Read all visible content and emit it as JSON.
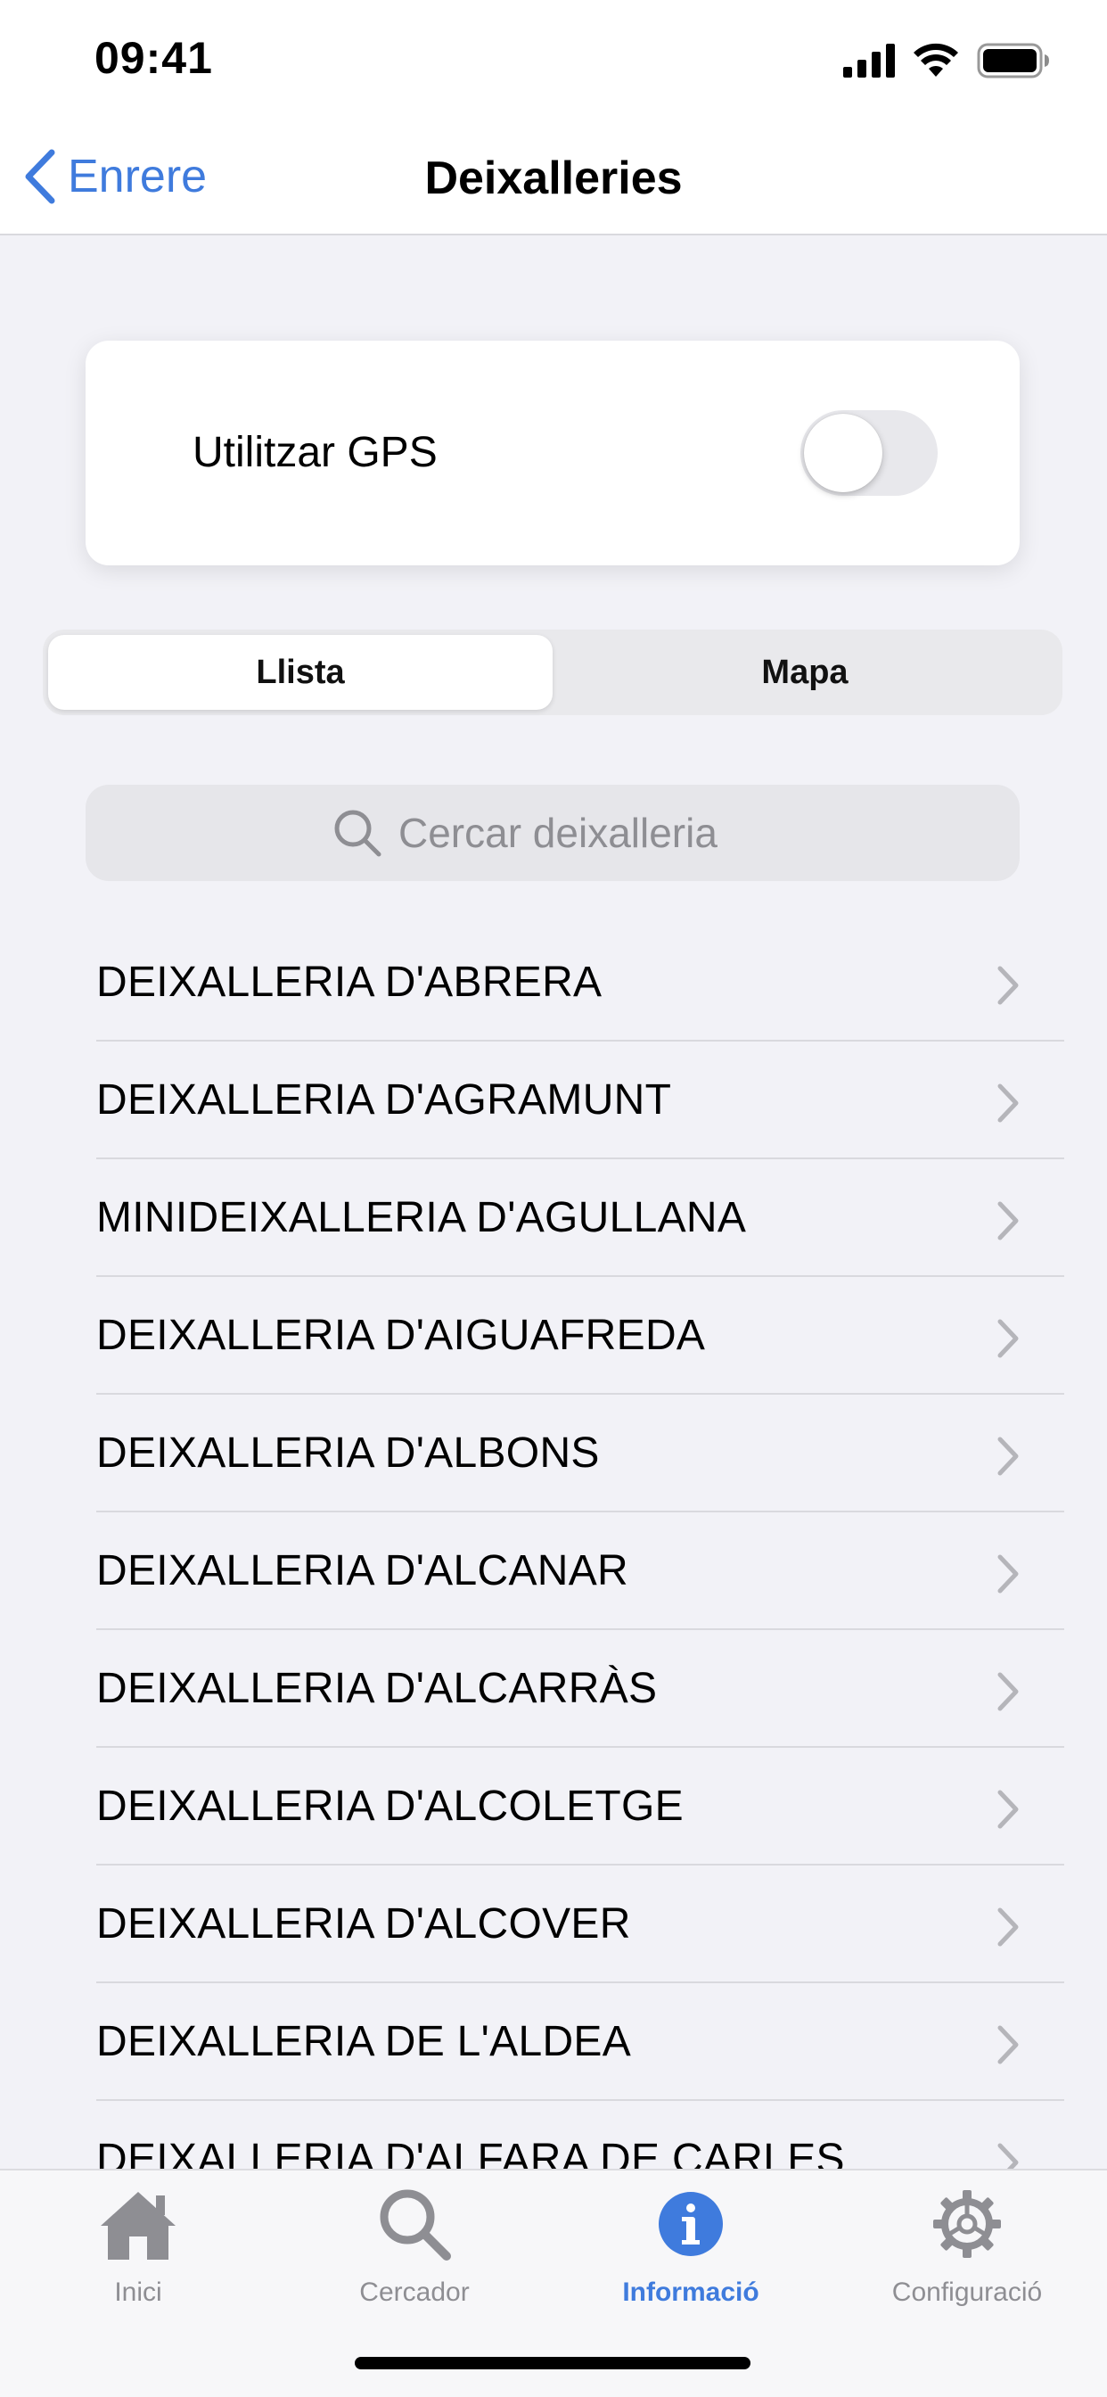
{
  "status_bar": {
    "time": "09:41"
  },
  "nav": {
    "back_label": "Enrere",
    "title": "Deixalleries"
  },
  "gps": {
    "label": "Utilitzar GPS",
    "enabled": false
  },
  "segments": {
    "list": "Llista",
    "map": "Mapa",
    "selected": "Llista"
  },
  "search": {
    "placeholder": "Cercar deixalleria",
    "value": ""
  },
  "items": [
    "DEIXALLERIA D'ABRERA",
    "DEIXALLERIA D'AGRAMUNT",
    "MINIDEIXALLERIA D'AGULLANA",
    "DEIXALLERIA D'AIGUAFREDA",
    "DEIXALLERIA D'ALBONS",
    "DEIXALLERIA D'ALCANAR",
    "DEIXALLERIA D'ALCARRÀS",
    "DEIXALLERIA D'ALCOLETGE",
    "DEIXALLERIA D'ALCOVER",
    "DEIXALLERIA DE L'ALDEA",
    "DEIXALLERIA D'ALFARA DE CARLES"
  ],
  "tabs": [
    {
      "label": "Inici",
      "icon": "house-icon"
    },
    {
      "label": "Cercador",
      "icon": "magnifier-icon"
    },
    {
      "label": "Informació",
      "icon": "info-icon"
    },
    {
      "label": "Configuració",
      "icon": "gear-icon"
    }
  ],
  "active_tab": "Informació",
  "colors": {
    "accent": "#3F7BDD",
    "inactive": "#8E8E93",
    "background": "#F2F2F7"
  }
}
